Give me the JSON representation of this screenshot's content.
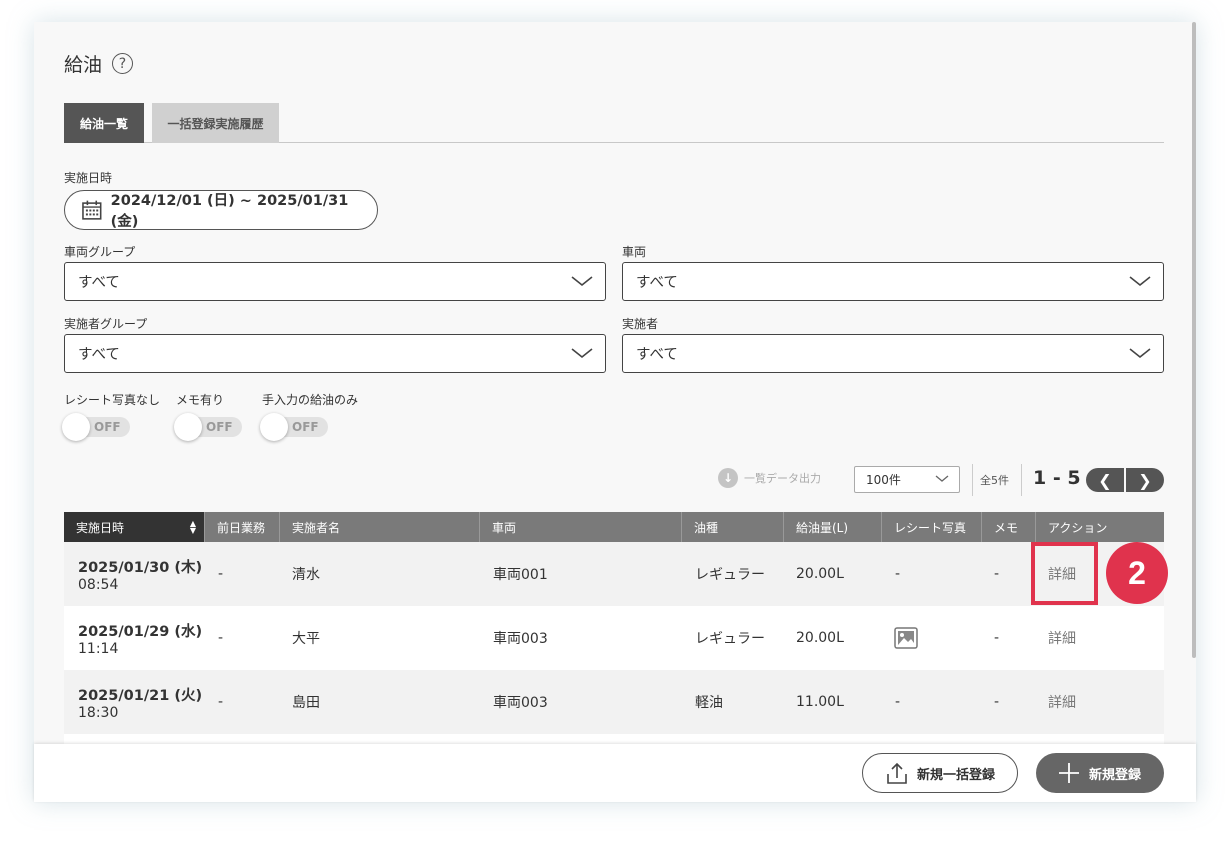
{
  "page": {
    "title": "給油",
    "help_icon": "?"
  },
  "tabs": [
    {
      "label": "給油一覧",
      "active": true
    },
    {
      "label": "一括登録実施履歴",
      "active": false
    }
  ],
  "filters": {
    "date_label": "実施日時",
    "date_range": "2024/12/01 (日) ~ 2025/01/31 (金)",
    "vehicle_group_label": "車両グループ",
    "vehicle_group_value": "すべて",
    "vehicle_label": "車両",
    "vehicle_value": "すべて",
    "operator_group_label": "実施者グループ",
    "operator_group_value": "すべて",
    "operator_label": "実施者",
    "operator_value": "すべて"
  },
  "toggles": [
    {
      "label": "レシート写真なし",
      "state": "OFF"
    },
    {
      "label": "メモ有り",
      "state": "OFF"
    },
    {
      "label": "手入力の給油のみ",
      "state": "OFF"
    }
  ],
  "toolbar": {
    "export_label": "一覧データ出力",
    "per_page": "100件",
    "total": "全5件",
    "range": "1 - 5",
    "prev": "❮",
    "next": "❯"
  },
  "table": {
    "headers": [
      "実施日時",
      "前日業務",
      "実施者名",
      "車両",
      "油種",
      "給油量(L)",
      "レシート写真",
      "メモ",
      "アクション"
    ],
    "rows": [
      {
        "date": "2025/01/30 (木)",
        "time": "08:54",
        "prev_work": "-",
        "operator": "清水",
        "vehicle": "車両001",
        "fuel_type": "レギュラー",
        "amount": "20.00L",
        "receipt": "-",
        "memo": "-",
        "action": "詳細"
      },
      {
        "date": "2025/01/29 (水)",
        "time": "11:14",
        "prev_work": "-",
        "operator": "大平",
        "vehicle": "車両003",
        "fuel_type": "レギュラー",
        "amount": "20.00L",
        "receipt": "image-icon",
        "memo": "-",
        "action": "詳細"
      },
      {
        "date": "2025/01/21 (火)",
        "time": "18:30",
        "prev_work": "-",
        "operator": "島田",
        "vehicle": "車両003",
        "fuel_type": "軽油",
        "amount": "11.00L",
        "receipt": "-",
        "memo": "-",
        "action": "詳細"
      }
    ]
  },
  "annotation": {
    "step": "2",
    "color": "#e0334d"
  },
  "footer": {
    "bulk_button": "新規一括登録",
    "new_button": "新規登録"
  }
}
